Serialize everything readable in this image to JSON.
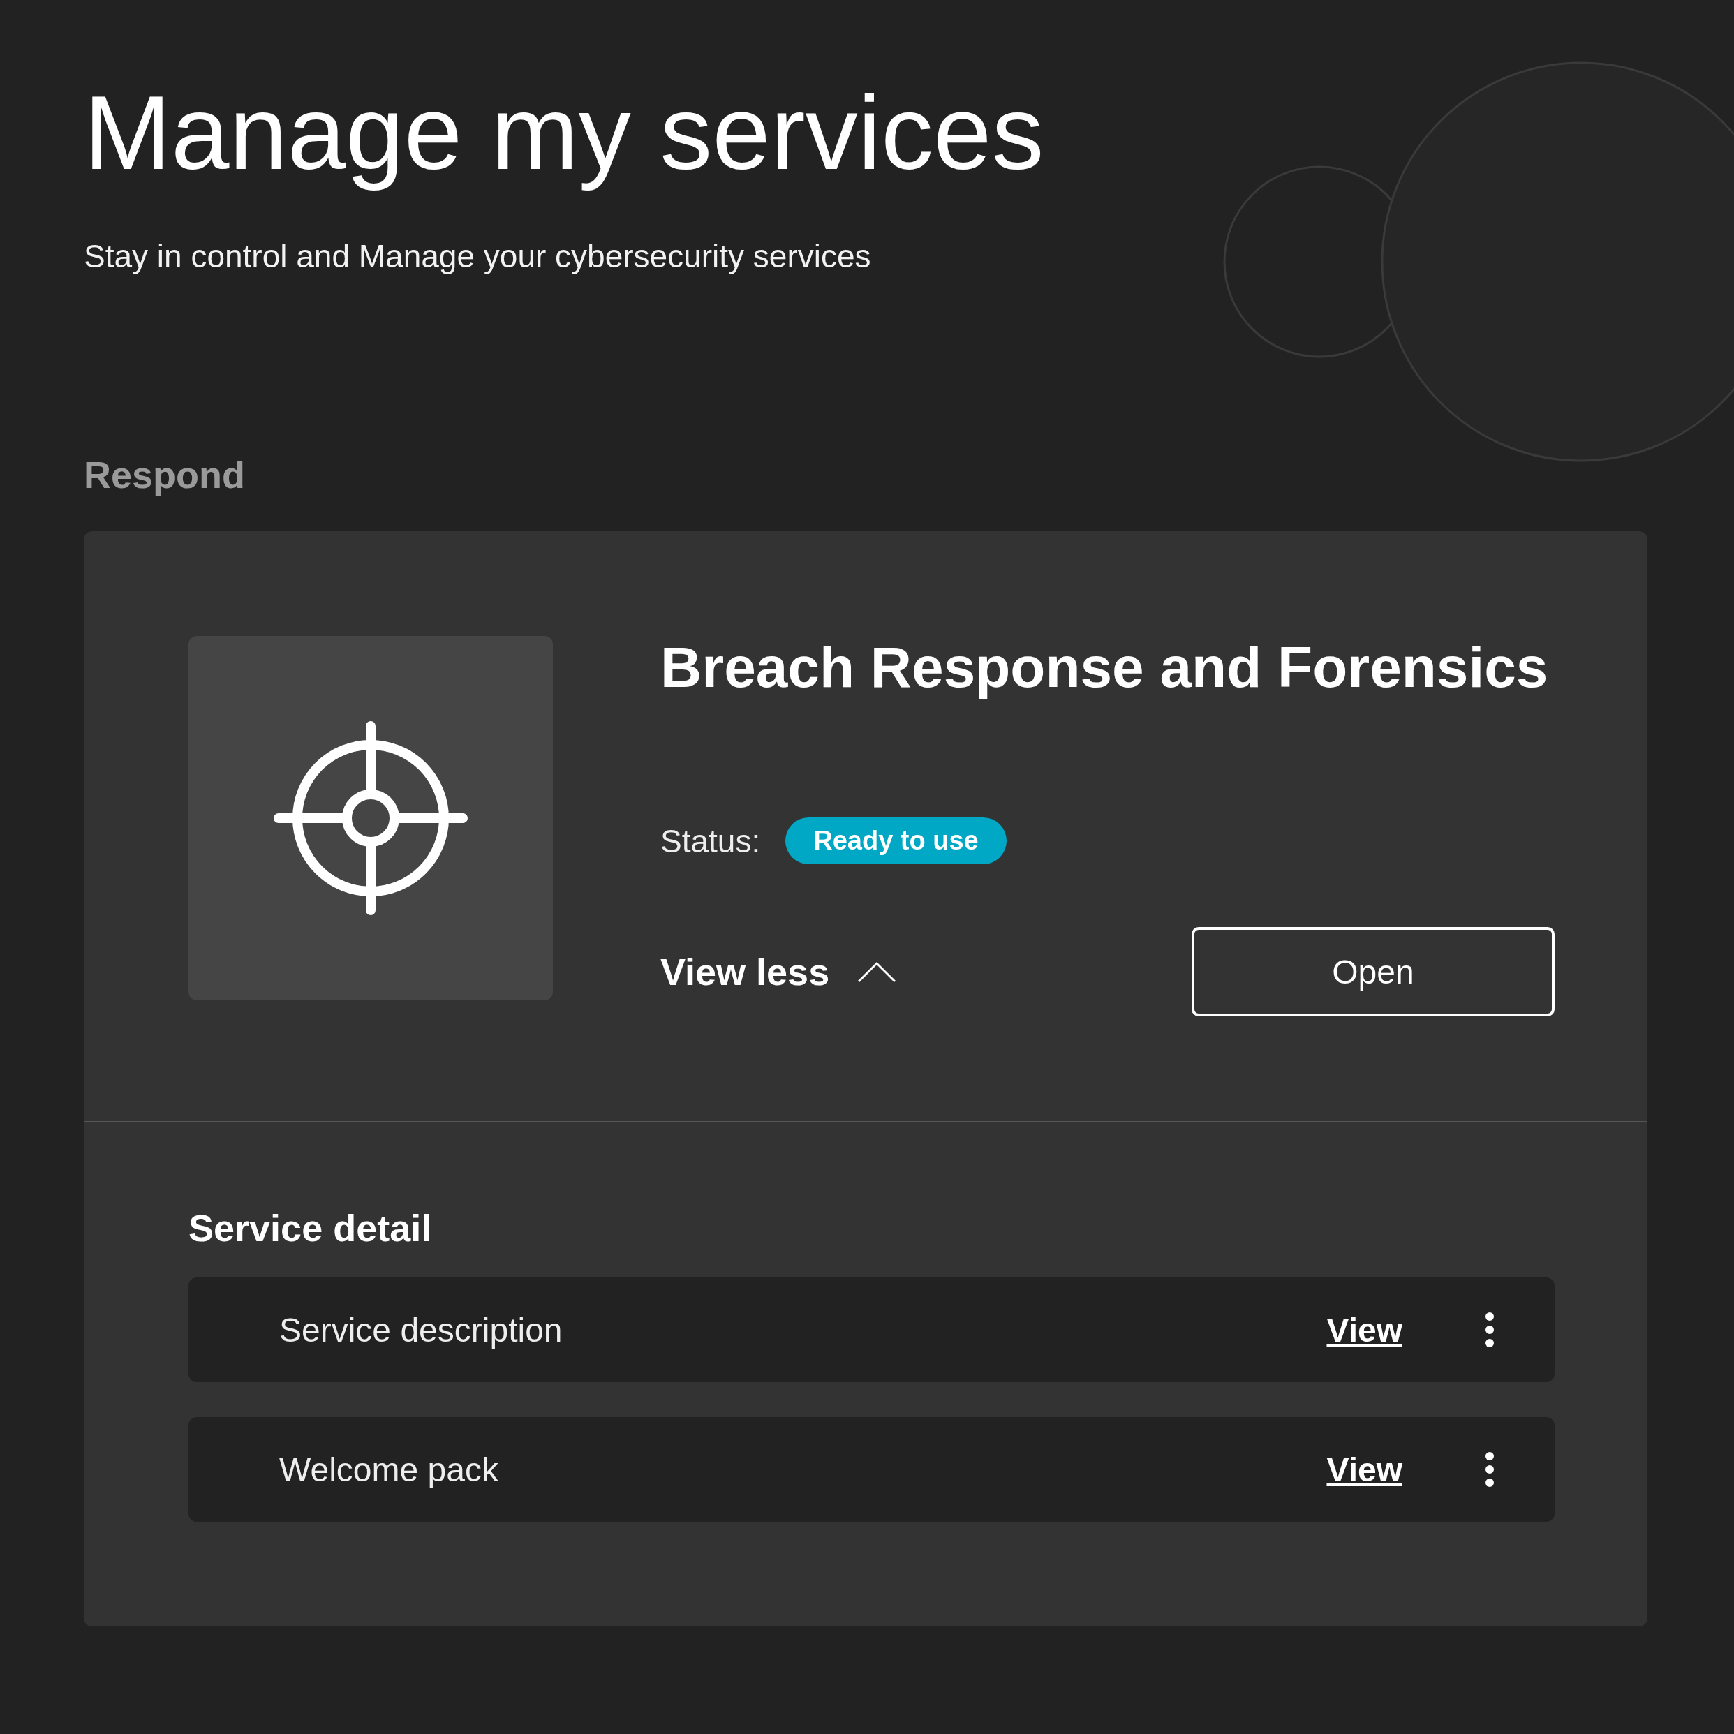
{
  "header": {
    "title": "Manage my services",
    "subtitle": "Stay in control and Manage your cybersecurity services"
  },
  "section": {
    "label": "Respond"
  },
  "service": {
    "name": "Breach Response and Forensics",
    "status_label": "Status:",
    "status": "Ready to use",
    "toggle_label": "View less",
    "expanded": true,
    "open_button": "Open",
    "detail_heading": "Service detail",
    "documents": [
      {
        "name": "Service description",
        "action": "View"
      },
      {
        "name": "Welcome pack",
        "action": "View"
      }
    ]
  }
}
